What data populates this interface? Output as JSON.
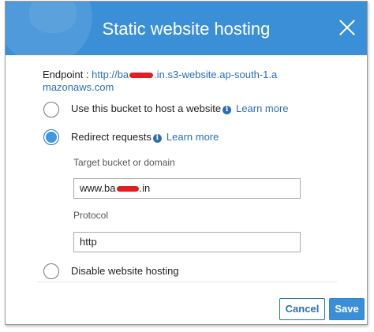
{
  "dialog": {
    "title": "Static website hosting",
    "close_icon": "close-icon"
  },
  "endpoint": {
    "label": "Endpoint :",
    "url_prefix": "http://ba",
    "url_suffix": ".in.s3-website.ap-south-1.amazonaws.com"
  },
  "options": [
    {
      "label": "Use this bucket to host a website",
      "learn_more": "Learn more",
      "selected": false
    },
    {
      "label": "Redirect requests",
      "learn_more": "Learn more",
      "selected": true
    },
    {
      "label": "Disable website hosting",
      "selected": false
    }
  ],
  "redirect": {
    "target_label": "Target bucket or domain",
    "target_value_prefix": "www.ba",
    "target_value_suffix": ".in",
    "protocol_label": "Protocol",
    "protocol_value": "http"
  },
  "buttons": {
    "cancel": "Cancel",
    "save": "Save"
  },
  "colors": {
    "header": "#3b8fd6",
    "link": "#2a6fb5",
    "redaction": "#e02020"
  }
}
